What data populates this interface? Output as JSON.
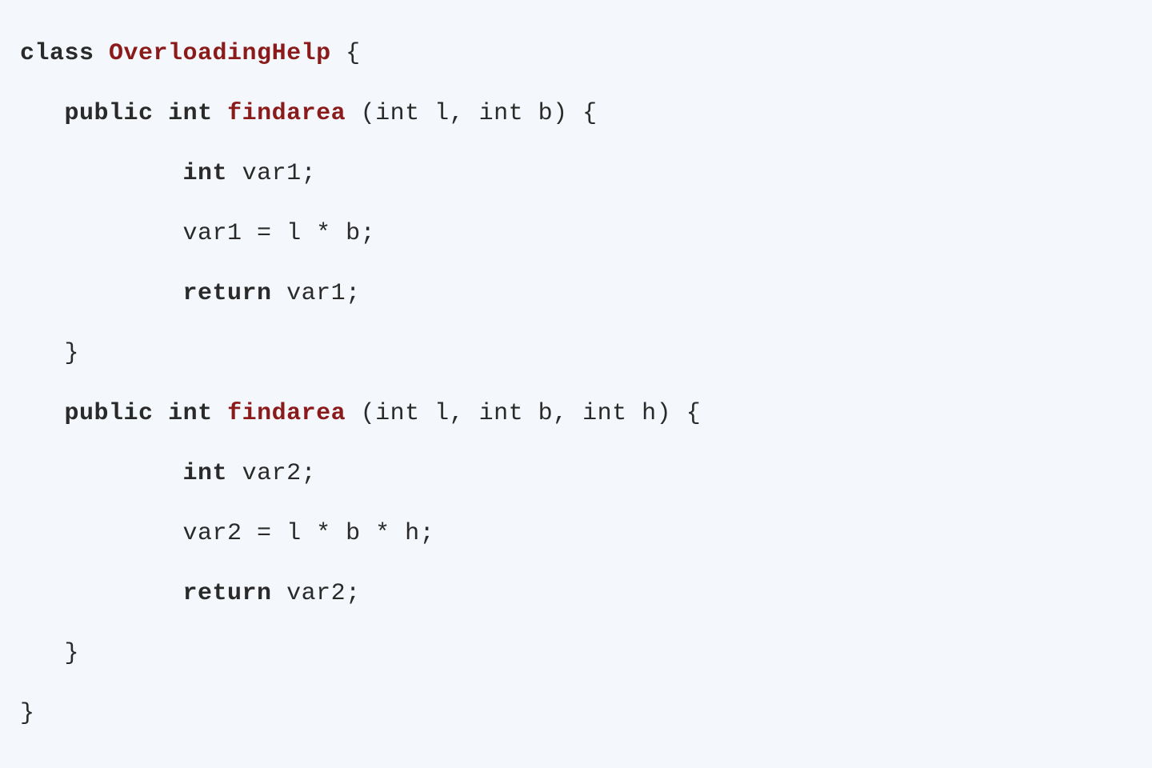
{
  "code": {
    "line1": {
      "keyword": "class",
      "space1": " ",
      "className": "OverloadingHelp",
      "rest": " {"
    },
    "line2": {
      "prefix": "   ",
      "keyword1": "public",
      "space1": " ",
      "keyword2": "int",
      "space2": " ",
      "methodName": "findarea",
      "rest": " (int l, int b) {"
    },
    "line3": {
      "prefix": "           ",
      "keyword": "int",
      "rest": " var1;"
    },
    "line4": {
      "prefix": "           ",
      "text": "var1 = l * b;"
    },
    "line5": {
      "prefix": "           ",
      "keyword": "return",
      "rest": " var1;"
    },
    "line6": {
      "text": "   }"
    },
    "line7": {
      "prefix": "   ",
      "keyword1": "public",
      "space1": " ",
      "keyword2": "int",
      "space2": " ",
      "methodName": "findarea",
      "rest": " (int l, int b, int h) {"
    },
    "line8": {
      "prefix": "           ",
      "keyword": "int",
      "rest": " var2;"
    },
    "line9": {
      "prefix": "           ",
      "text": "var2 = l * b * h;"
    },
    "line10": {
      "prefix": "           ",
      "keyword": "return",
      "rest": " var2;"
    },
    "line11": {
      "text": "   }"
    },
    "line12": {
      "text": "}"
    }
  }
}
